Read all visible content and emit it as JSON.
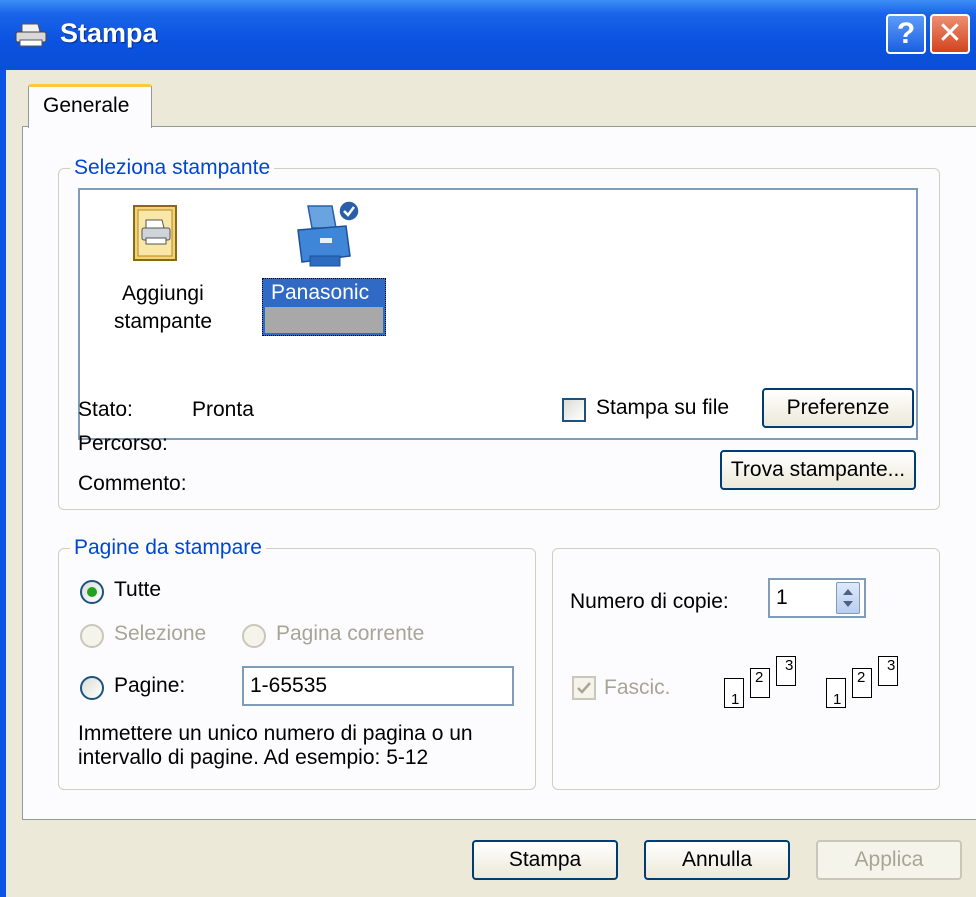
{
  "window": {
    "title": "Stampa",
    "help_glyph": "?",
    "close_glyph": "✕"
  },
  "tabs": [
    {
      "label": "Generale"
    }
  ],
  "select_printer": {
    "legend": "Seleziona stampante",
    "printers": [
      {
        "label_line1": "Aggiungi",
        "label_line2": "stampante",
        "icon": "add-printer-icon"
      },
      {
        "label": "Panasonic",
        "icon": "printer-icon",
        "selected": true,
        "default": true
      }
    ],
    "status_label": "Stato:",
    "status_value": "Pronta",
    "path_label": "Percorso:",
    "comment_label": "Commento:",
    "print_to_file_label": "Stampa su file",
    "preferences_label": "Preferenze",
    "find_printer_label": "Trova stampante..."
  },
  "page_range": {
    "legend": "Pagine da stampare",
    "all_label": "Tutte",
    "selection_label": "Selezione",
    "current_page_label": "Pagina corrente",
    "pages_label": "Pagine:",
    "pages_value": "1-65535",
    "hint_line1": "Immettere un unico numero di pagina o un",
    "hint_line2": "intervallo di pagine. Ad esempio: 5-12"
  },
  "copies": {
    "label": "Numero di copie:",
    "value": "1",
    "collate_label": "Fascic.",
    "collate_checked": true,
    "page_numbers": [
      "1",
      "2",
      "3"
    ]
  },
  "footer": {
    "print_label": "Stampa",
    "cancel_label": "Annulla",
    "apply_label": "Applica"
  },
  "colors": {
    "title_bar": "#0a52e0",
    "legend_text": "#0046d5",
    "selection": "#316ac5"
  }
}
